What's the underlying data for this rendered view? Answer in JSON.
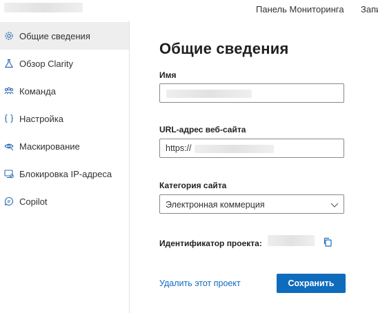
{
  "header": {
    "links": [
      "Панель Мониторинга",
      "Запи"
    ]
  },
  "sidebar": {
    "items": [
      {
        "label": "Общие сведения",
        "icon": "gear-icon",
        "active": true
      },
      {
        "label": "Обзор Clarity",
        "icon": "flask-icon",
        "active": false
      },
      {
        "label": "Команда",
        "icon": "team-icon",
        "active": false
      },
      {
        "label": "Настройка",
        "icon": "code-braces-icon",
        "active": false
      },
      {
        "label": "Маскирование",
        "icon": "eye-mask-icon",
        "active": false
      },
      {
        "label": "Блокировка IP-адреса",
        "icon": "ip-block-icon",
        "active": false
      },
      {
        "label": "Copilot",
        "icon": "chat-icon",
        "active": false
      }
    ]
  },
  "main": {
    "title": "Общие сведения",
    "name_label": "Имя",
    "name_value": "",
    "url_label": "URL-адрес веб-сайта",
    "url_value": "https://",
    "category_label": "Категория сайта",
    "category_value": "Электронная коммерция",
    "project_id_label": "Идентификатор проекта:",
    "delete_link": "Удалить этот проект",
    "save_button": "Сохранить"
  },
  "colors": {
    "accent": "#0f6cbd",
    "icon_blue": "#2b68b5",
    "active_bg": "#eeeeee"
  }
}
